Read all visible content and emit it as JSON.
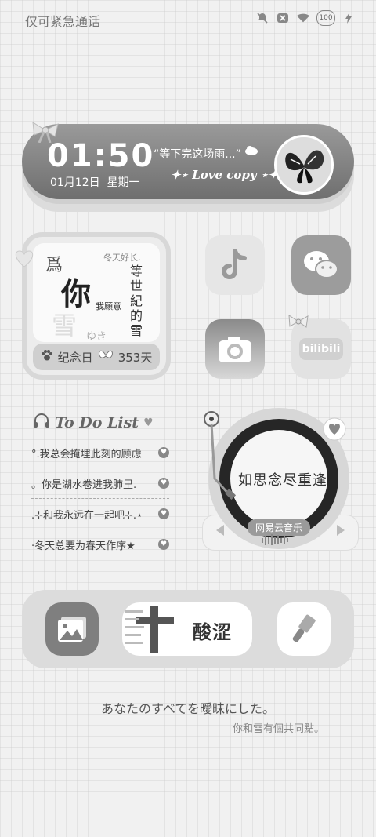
{
  "status": {
    "carrier": "仅可紧急通话",
    "battery": "100"
  },
  "clock": {
    "time": "01:50",
    "date": "01月12日",
    "weekday": "星期一",
    "quote": "“等下完这场雨...”",
    "love": "Love copy"
  },
  "memorial": {
    "c1": "爲",
    "c2": "你",
    "c3": "我願意",
    "c4": "等",
    "c5": "世",
    "c6": "紀",
    "c7": "的",
    "c8": "雪",
    "small": "冬天好长,",
    "yuki": "ゆき",
    "label": "纪念日",
    "days": "353天"
  },
  "apps": [
    {
      "name": "tiktok"
    },
    {
      "name": "wechat"
    },
    {
      "name": "camera"
    },
    {
      "name": "bilibili",
      "label": "bilibili"
    }
  ],
  "todo": {
    "title": "To Do List",
    "items": [
      "°.我总会掩埋此刻的顾虑",
      "。你是湖水卷进我肺里.",
      ".⊹和我永远在一起吧⊹.⋆",
      "·冬天总要为春天作序★"
    ]
  },
  "music": {
    "label": "网易云音乐",
    "disc_text": "如思念尽重逢"
  },
  "dock": {
    "banner": "酸涩"
  },
  "footer": {
    "line1": "あなたのすべてを曖昧にした。",
    "line2": "你和雪有個共同點。"
  }
}
